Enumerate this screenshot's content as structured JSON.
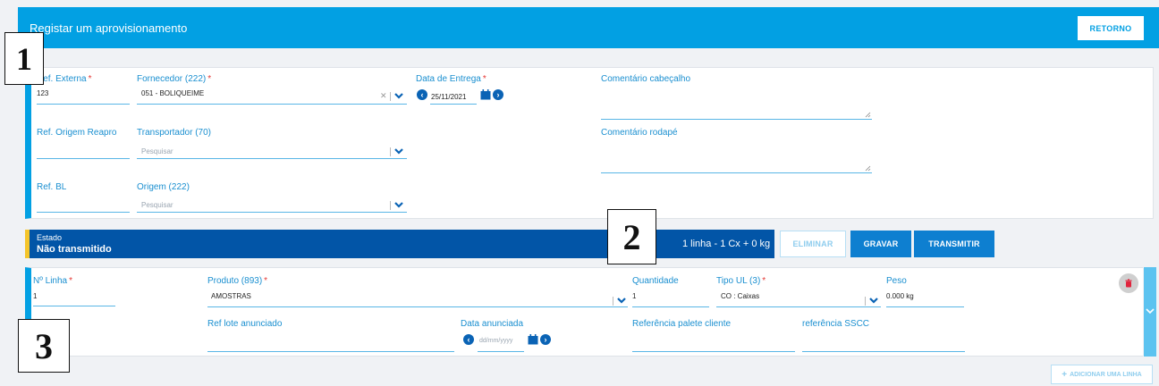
{
  "header": {
    "title": "Registar um aprovisionamento",
    "return_label": "RETORNO"
  },
  "form": {
    "ref_externa": {
      "label": "Ref. Externa",
      "required": "*",
      "value": "123"
    },
    "fornecedor": {
      "label": "Fornecedor (222)",
      "required": "*",
      "value": "051 - BOLIQUEIME"
    },
    "data_entrega": {
      "label": "Data de Entrega",
      "required": "*",
      "value": "25/11/2021"
    },
    "comentario_cabecalho": {
      "label": "Comentário cabeçalho"
    },
    "ref_origem_reapro": {
      "label": "Ref. Origem Reapro"
    },
    "transportador": {
      "label": "Transportador (70)",
      "placeholder": "Pesquisar"
    },
    "comentario_rodape": {
      "label": "Comentário rodapé"
    },
    "ref_bl": {
      "label": "Ref. BL"
    },
    "origem": {
      "label": "Origem (222)",
      "placeholder": "Pesquisar"
    }
  },
  "status": {
    "label": "Estado",
    "value": "Não transmitido",
    "summary": "1 linha - 1 Cx + 0 kg"
  },
  "actions": {
    "eliminar": "ELIMINAR",
    "gravar": "GRAVAR",
    "transmitir": "TRANSMITIR"
  },
  "line": {
    "n_linha": {
      "label": "Nº Linha",
      "required": "*",
      "value": "1"
    },
    "produto": {
      "label": "Produto (893)",
      "required": "*",
      "value": "AMOSTRAS"
    },
    "quantidade": {
      "label": "Quantidade",
      "value": "1"
    },
    "tipo_ul": {
      "label": "Tipo UL (3)",
      "required": "*",
      "value": "CO : Caixas"
    },
    "peso": {
      "label": "Peso",
      "value": "0.000 kg"
    },
    "ref_lote": {
      "label": "Ref lote anunciado"
    },
    "data_anunciada": {
      "label": "Data anunciada",
      "placeholder": "dd/mm/yyyy"
    },
    "ref_palete": {
      "label": "Referência palete cliente"
    },
    "ref_sscc": {
      "label": "referência SSCC"
    }
  },
  "add_line_label": "ADICIONAR UMA LINHA",
  "annotations": [
    "1",
    "2",
    "3"
  ],
  "colors": {
    "header": "#02a0e3",
    "status_bar": "#0255a7",
    "status_accent": "#f4c52a",
    "primary_button": "#0e7fd0",
    "label": "#1a8fd0",
    "required": "#e53935"
  }
}
